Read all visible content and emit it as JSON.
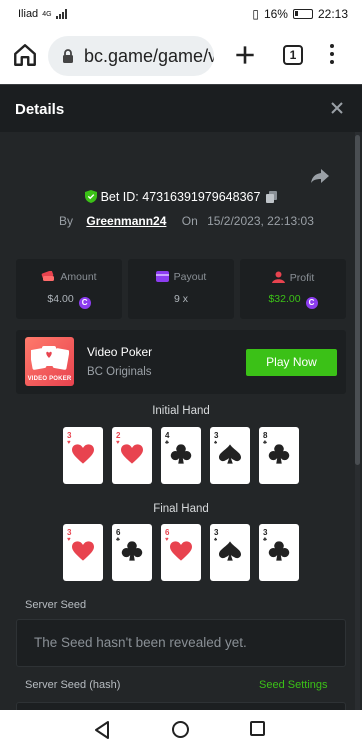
{
  "status_bar": {
    "carrier": "Iliad",
    "network": "4G",
    "battery": "16%",
    "time": "22:13"
  },
  "browser": {
    "url": "bc.game/game/v",
    "tab_count": "1"
  },
  "details": {
    "title": "Details",
    "bet_id": "Bet ID: 47316391979648367",
    "by_label": "By",
    "username": "Greenmann24",
    "on_label": "On",
    "datetime": "15/2/2023, 22:13:03",
    "stats": [
      {
        "label": "Amount",
        "value": "$4.00",
        "icon": "coins-icon",
        "color": "#e8434f"
      },
      {
        "label": "Payout",
        "value": "9 x",
        "icon": "payout-icon",
        "color": "#8c3df0"
      },
      {
        "label": "Profit",
        "value": "$32.00",
        "icon": "profit-icon",
        "color": "#e8434f"
      }
    ],
    "game": {
      "name": "Video Poker",
      "provider": "BC Originals",
      "thumb_caption": "VIDEO POKER",
      "play_label": "Play Now"
    },
    "initial_hand_label": "Initial Hand",
    "final_hand_label": "Final Hand",
    "initial_hand": [
      {
        "rank": "3",
        "suit": "hearts"
      },
      {
        "rank": "2",
        "suit": "hearts"
      },
      {
        "rank": "4",
        "suit": "clubs"
      },
      {
        "rank": "3",
        "suit": "spades"
      },
      {
        "rank": "8",
        "suit": "clubs"
      }
    ],
    "final_hand": [
      {
        "rank": "3",
        "suit": "hearts"
      },
      {
        "rank": "6",
        "suit": "clubs"
      },
      {
        "rank": "6",
        "suit": "hearts"
      },
      {
        "rank": "3",
        "suit": "spades"
      },
      {
        "rank": "3",
        "suit": "clubs"
      }
    ],
    "server_seed_label": "Server Seed",
    "server_seed_value": "The Seed hasn't been revealed yet.",
    "server_seed_hash_label": "Server Seed (hash)",
    "seed_settings_label": "Seed Settings"
  },
  "colors": {
    "accent_green": "#3bc117",
    "panel_bg": "#232628",
    "card_bg": "#1c1f21",
    "heart_red": "#e8434f",
    "coin_purple": "#8c3df0"
  }
}
